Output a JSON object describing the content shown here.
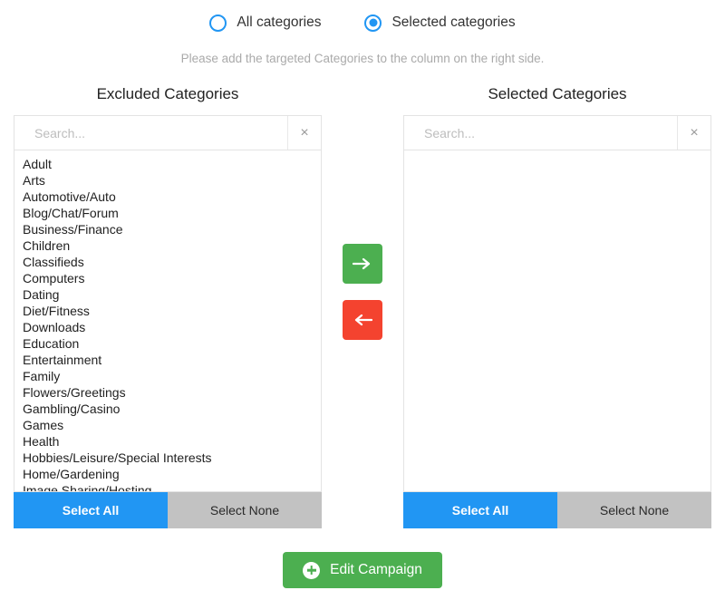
{
  "mode_selector": {
    "options": [
      {
        "label": "All categories",
        "checked": false,
        "icon": "radio-unchecked-icon"
      },
      {
        "label": "Selected categories",
        "checked": true,
        "icon": "radio-checked-icon"
      }
    ]
  },
  "instruction": "Please add the targeted Categories to the column on the right side.",
  "colors": {
    "accent_blue": "#2196F3",
    "green": "#4CAF50",
    "red": "#F4432F",
    "gray": "#C2C2C2"
  },
  "excluded": {
    "title": "Excluded Categories",
    "search": {
      "value": "",
      "placeholder": "Search...",
      "clear_label": "×"
    },
    "items": [
      "Adult",
      "Arts",
      "Automotive/Auto",
      "Blog/Chat/Forum",
      "Business/Finance",
      "Children",
      "Classifieds",
      "Computers",
      "Dating",
      "Diet/Fitness",
      "Downloads",
      "Education",
      "Entertainment",
      "Family",
      "Flowers/Greetings",
      "Gambling/Casino",
      "Games",
      "Health",
      "Hobbies/Leisure/Special Interests",
      "Home/Gardening",
      "Image Sharing/Hosting"
    ],
    "select_all_label": "Select All",
    "select_none_label": "Select None"
  },
  "selected": {
    "title": "Selected Categories",
    "search": {
      "value": "",
      "placeholder": "Search...",
      "clear_label": "×"
    },
    "items": [],
    "select_all_label": "Select All",
    "select_none_label": "Select None"
  },
  "transfer": {
    "move_right_icon": "arrow-right-icon",
    "move_left_icon": "arrow-left-icon"
  },
  "footer": {
    "submit_label": "Edit Campaign",
    "submit_icon": "plus-circle-icon"
  }
}
